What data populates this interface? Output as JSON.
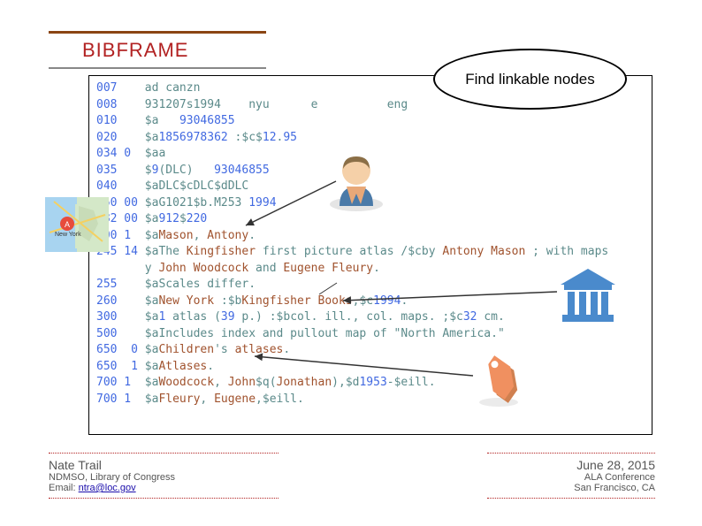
{
  "title": "BIBFRAME",
  "callout": "Find linkable nodes",
  "marc": [
    {
      "tag": "007",
      "ind": "",
      "content": "ad canzn"
    },
    {
      "tag": "008",
      "ind": "",
      "content": "931207s1994    nyu      e          eng"
    },
    {
      "tag": "010",
      "ind": "",
      "content": "$a   93046855"
    },
    {
      "tag": "020",
      "ind": "",
      "content": "$a1856978362 :$c$12.95"
    },
    {
      "tag": "034",
      "ind": "0 ",
      "content": "$aa"
    },
    {
      "tag": "035",
      "ind": "",
      "content": "$9(DLC)   93046855"
    },
    {
      "tag": "040",
      "ind": "",
      "content": "$aDLC$cDLC$dDLC"
    },
    {
      "tag": "050",
      "ind": "00",
      "content": "$aG1021$b.M253 1994"
    },
    {
      "tag": "082",
      "ind": "00",
      "content": "$a912$220"
    },
    {
      "tag": "100",
      "ind": "1 ",
      "content": "$aMason, Antony."
    },
    {
      "tag": "245",
      "ind": "14",
      "content": "$aThe Kingfisher first picture atlas /$cby Antony Mason ; with maps"
    },
    {
      "tag": "",
      "ind": "",
      "content": "y John Woodcock and Eugene Fleury."
    },
    {
      "tag": "255",
      "ind": "",
      "content": "$aScales differ."
    },
    {
      "tag": "260",
      "ind": "",
      "content": "$aNew York :$bKingfisher Books,$c1994."
    },
    {
      "tag": "300",
      "ind": "",
      "content": "$a1 atlas (39 p.) :$bcol. ill., col. maps. ;$c32 cm."
    },
    {
      "tag": "500",
      "ind": "",
      "content": "$aIncludes index and pullout map of \"North America.\""
    },
    {
      "tag": "650",
      "ind": " 0",
      "content": "$aChildren's atlases."
    },
    {
      "tag": "650",
      "ind": " 1",
      "content": "$aAtlases."
    },
    {
      "tag": "700",
      "ind": "1 ",
      "content": "$aWoodcock, John$q(Jonathan),$d1953-$eill."
    },
    {
      "tag": "700",
      "ind": "1 ",
      "content": "$aFleury, Eugene,$eill."
    }
  ],
  "footer": {
    "author": "Nate Trail",
    "org": "NDMSO, Library of Congress",
    "email_label": "Email: ",
    "email": "ntra@loc.gov",
    "date": "June 28, 2015",
    "conference": "ALA Conference",
    "location": "San Francisco, CA"
  }
}
